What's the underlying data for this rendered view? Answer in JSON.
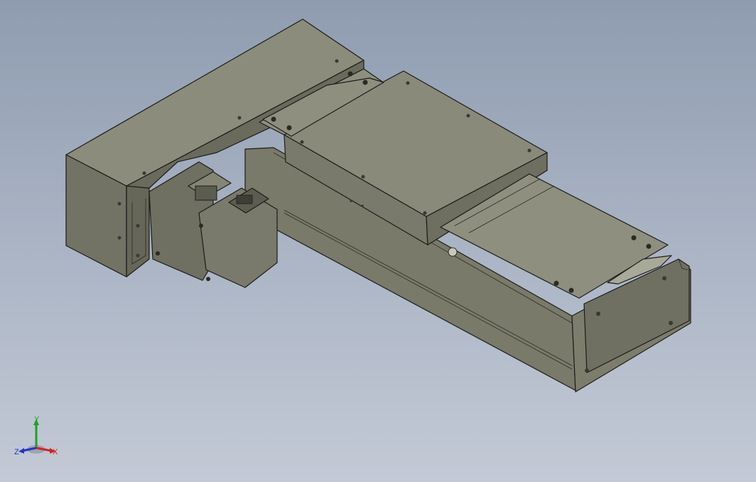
{
  "viewport": {
    "background_top": "#8f9cb0",
    "background_bottom": "#c3cad6",
    "model_color": "#7d7d6e"
  },
  "triad": {
    "x_label": "X",
    "y_label": "Y",
    "z_label": "Z",
    "x_color": "#d42020",
    "y_color": "#1fa024",
    "z_color": "#2334c8"
  }
}
